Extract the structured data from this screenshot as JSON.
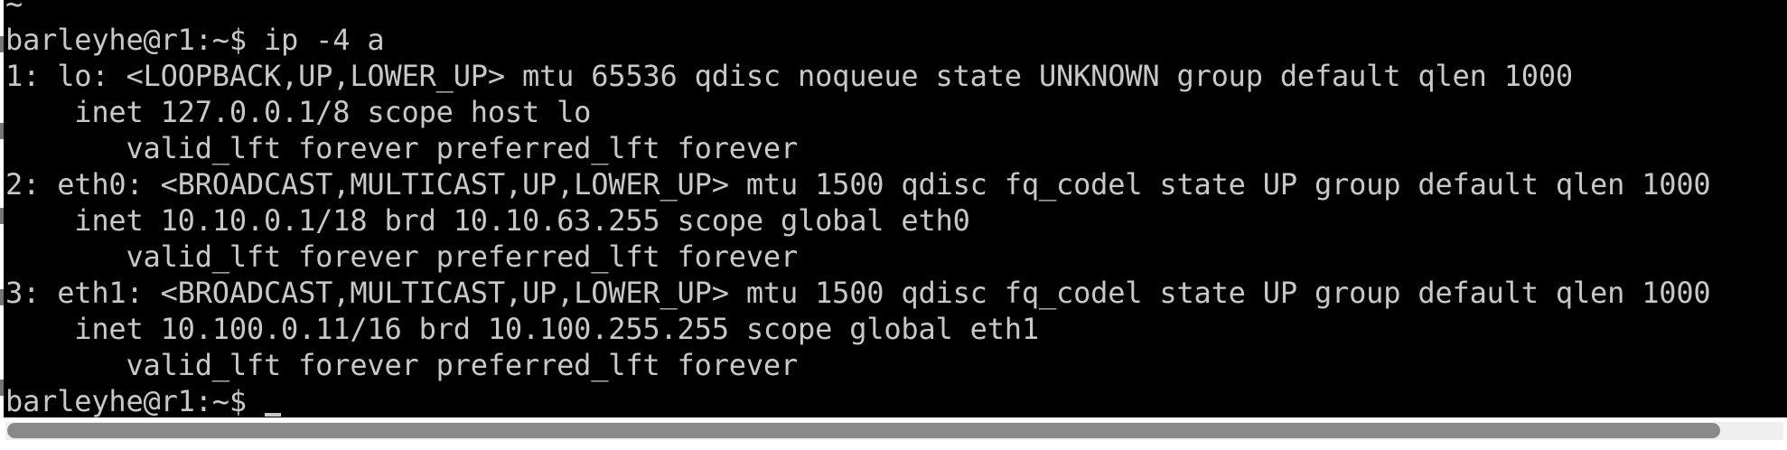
{
  "terminal": {
    "previous_line_fragment": "~",
    "lines": [
      "barleyhe@r1:~$ ip -4 a",
      "1: lo: <LOOPBACK,UP,LOWER_UP> mtu 65536 qdisc noqueue state UNKNOWN group default qlen 1000",
      "    inet 127.0.0.1/8 scope host lo",
      "       valid_lft forever preferred_lft forever",
      "2: eth0: <BROADCAST,MULTICAST,UP,LOWER_UP> mtu 1500 qdisc fq_codel state UP group default qlen 1000",
      "    inet 10.10.0.1/18 brd 10.10.63.255 scope global eth0",
      "       valid_lft forever preferred_lft forever",
      "3: eth1: <BROADCAST,MULTICAST,UP,LOWER_UP> mtu 1500 qdisc fq_codel state UP group default qlen 1000",
      "    inet 10.100.0.11/16 brd 10.100.255.255 scope global eth1",
      "       valid_lft forever preferred_lft forever"
    ],
    "prompt": "barleyhe@r1:~$ "
  },
  "scrollbar": {
    "orientation": "horizontal"
  },
  "colors": {
    "terminal_background": "#000000",
    "terminal_text": "#c8c8c8",
    "scroll_thumb": "#8a8a8a",
    "scroll_track": "#efefef"
  }
}
